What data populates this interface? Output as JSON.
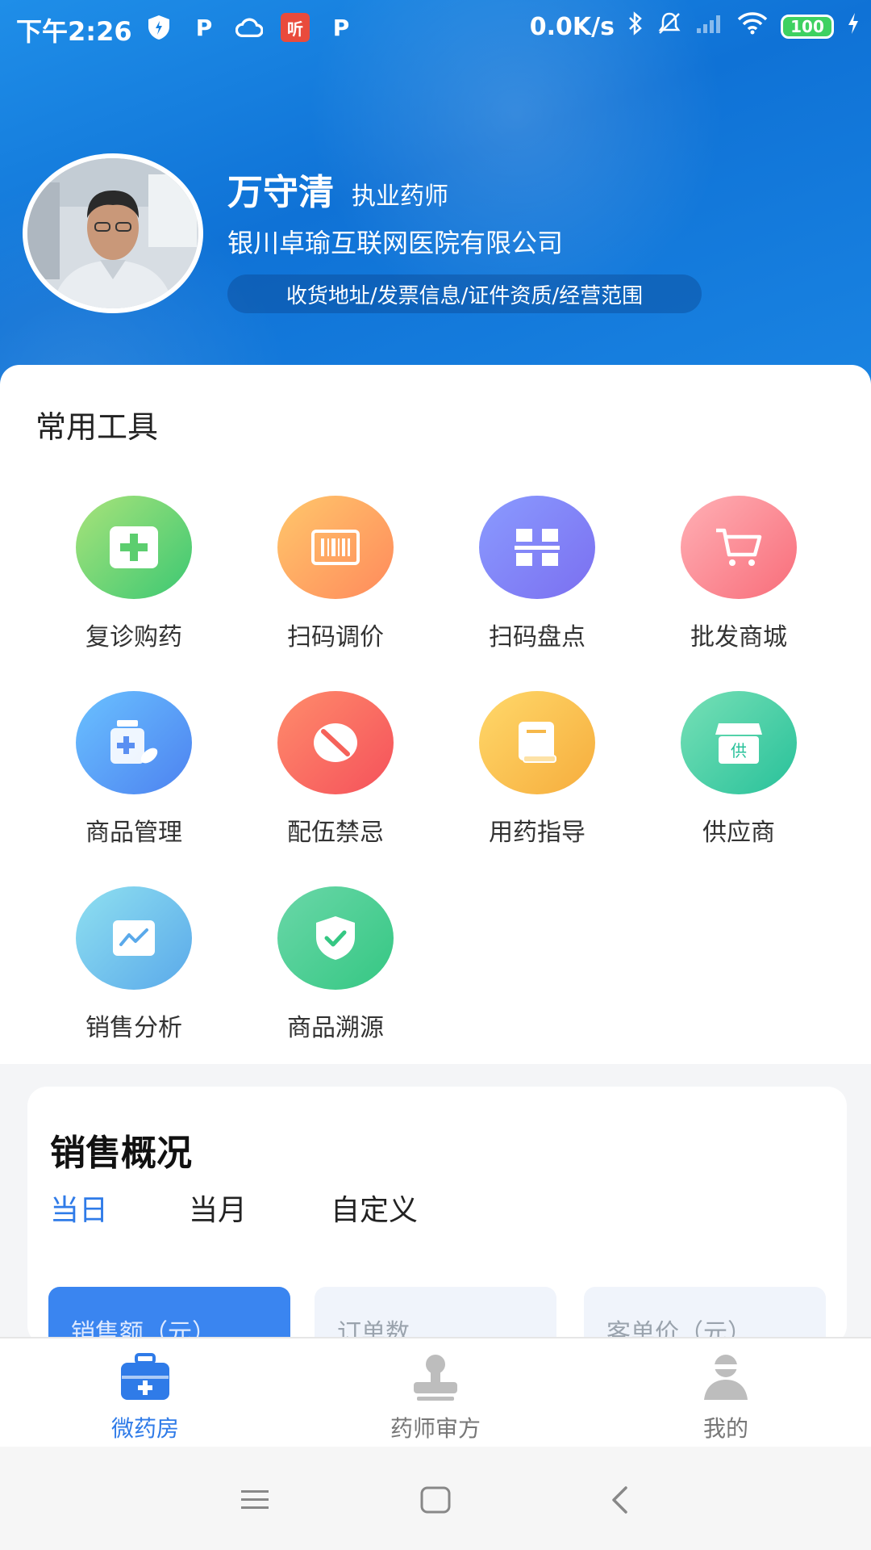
{
  "status_bar": {
    "time": "下午2:26",
    "net_speed": "0.0K/s",
    "battery": "100",
    "left_icons": [
      "shield-icon",
      "p-icon",
      "cloud-icon",
      "ting-icon",
      "p-icon"
    ],
    "ting_label": "听",
    "p_label": "P"
  },
  "profile": {
    "name": "万守清",
    "role": "执业药师",
    "company": "银川卓瑜互联网医院有限公司",
    "info_link": "收货地址/发票信息/证件资质/经营范围"
  },
  "tools": {
    "title": "常用工具",
    "items": [
      {
        "label": "复诊购药",
        "icon": "medicine-plus-icon",
        "color": "#3cc873"
      },
      {
        "label": "扫码调价",
        "icon": "barcode-icon",
        "color": "#ff8a5c"
      },
      {
        "label": "扫码盘点",
        "icon": "scan-grid-icon",
        "color": "#7b6ff0"
      },
      {
        "label": "批发商城",
        "icon": "cart-icon",
        "color": "#f86d7a"
      },
      {
        "label": "商品管理",
        "icon": "medicine-bottle-icon",
        "color": "#4d82f0"
      },
      {
        "label": "配伍禁忌",
        "icon": "forbidden-icon",
        "color": "#f5515b"
      },
      {
        "label": "用药指导",
        "icon": "book-icon",
        "color": "#f6ad3d"
      },
      {
        "label": "供应商",
        "icon": "supplier-shop-icon",
        "color": "#28c19a"
      },
      {
        "label": "销售分析",
        "icon": "chart-icon",
        "color": "#5aa9ea"
      },
      {
        "label": "商品溯源",
        "icon": "shield-check-icon",
        "color": "#35c783"
      }
    ],
    "supplier_badge": "供"
  },
  "sales": {
    "title": "销售概况",
    "tabs": [
      "当日",
      "当月",
      "自定义"
    ],
    "active_tab": "当日",
    "metrics": [
      "销售额（元）",
      "订单数",
      "客单价（元）"
    ]
  },
  "bottom_nav": {
    "items": [
      {
        "label": "微药房",
        "icon": "medkit-icon"
      },
      {
        "label": "药师审方",
        "icon": "stamp-icon"
      },
      {
        "label": "我的",
        "icon": "user-icon"
      }
    ],
    "active": "微药房"
  },
  "colors": {
    "accent": "#2f7be8",
    "header_blue": "#1580e0"
  }
}
